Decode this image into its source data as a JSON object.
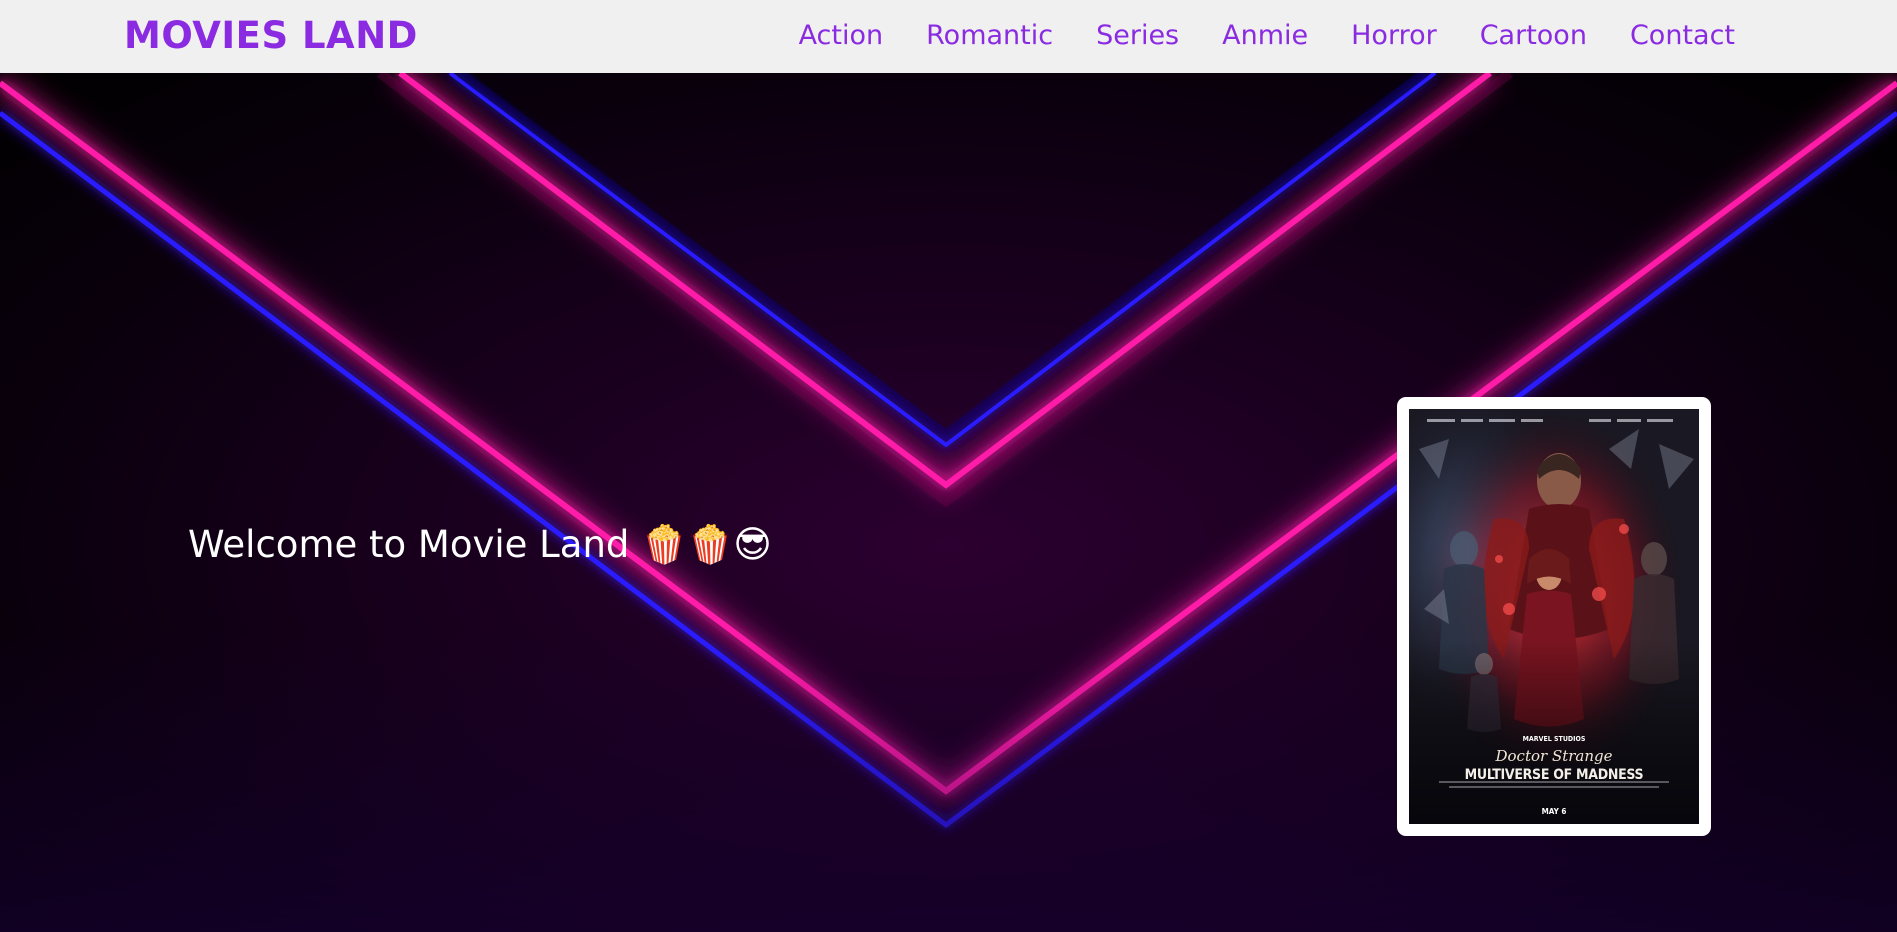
{
  "navbar": {
    "brand": "MOVIES LAND",
    "links": [
      {
        "label": "Action"
      },
      {
        "label": "Romantic"
      },
      {
        "label": "Series"
      },
      {
        "label": "Anmie"
      },
      {
        "label": "Horror"
      },
      {
        "label": "Cartoon"
      },
      {
        "label": "Contact"
      }
    ]
  },
  "hero": {
    "welcome_text": "Welcome to Movie Land 🍿🍿😎",
    "poster": {
      "studio": "MARVEL STUDIOS",
      "title_line1": "Doctor Strange",
      "title_line2": "MULTIVERSE OF MADNESS",
      "date": "MAY 6"
    }
  },
  "colors": {
    "brand": "#8a2be2",
    "navbar_bg": "#f0f0f0",
    "neon_pink": "#ff1aa8",
    "neon_blue": "#2a1aff"
  }
}
